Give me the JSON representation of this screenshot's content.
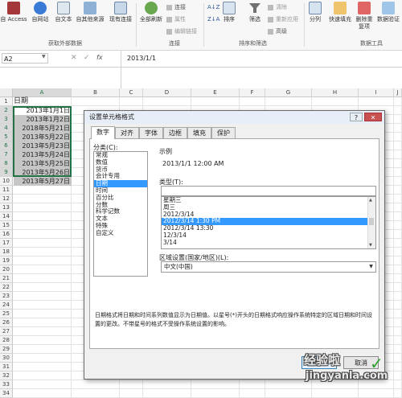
{
  "ribbon": {
    "group1": {
      "buttons": [
        "自 Access",
        "自网站",
        "自文本",
        "自其他来源",
        "现有连接"
      ],
      "label": "获取外部数据"
    },
    "group2": {
      "refresh_label": "全部刷新",
      "small": [
        "连接",
        "属性",
        "编辑链接"
      ],
      "label": "连接"
    },
    "group3": {
      "sort_az": "A↓Z",
      "sort_za": "Z↓A",
      "sort_label": "排序",
      "filter_label": "筛选",
      "small": [
        "清除",
        "重新应用",
        "高级"
      ],
      "label": "排序和筛选"
    },
    "group4": {
      "buttons": [
        "分列",
        "快速填充",
        "删除重复项",
        "数据验证"
      ],
      "label": "数据工具"
    }
  },
  "formula_bar": {
    "name_box": "A2",
    "fx": "fx",
    "value": "2013/1/1"
  },
  "grid": {
    "columns": [
      "A",
      "B",
      "C",
      "D",
      "E",
      "F",
      "G",
      "H",
      "I",
      "J"
    ],
    "rows": [
      "1",
      "2",
      "3",
      "4",
      "5",
      "6",
      "7",
      "8",
      "9",
      "10",
      "11",
      "12",
      "13",
      "14",
      "15",
      "16",
      "17",
      "18",
      "19",
      "20",
      "21",
      "22",
      "23",
      "24",
      "25",
      "26",
      "27",
      "28",
      "29",
      "30",
      "31",
      "32",
      "33",
      "34"
    ],
    "header_cell": "日期",
    "cells": [
      "2013年1月1日",
      "2013年1月2日",
      "2018年5月21日",
      "2013年5月22日",
      "2013年5月23日",
      "2013年5月24日",
      "2013年5月25日",
      "2013年5月26日",
      "2013年5月27日"
    ]
  },
  "dialog": {
    "title": "设置单元格格式",
    "help": "?",
    "close": "✕",
    "tabs": [
      "数字",
      "对齐",
      "字体",
      "边框",
      "填充",
      "保护"
    ],
    "category_label": "分类(C):",
    "categories": [
      "常规",
      "数值",
      "货币",
      "会计专用",
      "日期",
      "时间",
      "百分比",
      "分数",
      "科学记数",
      "文本",
      "特殊",
      "自定义"
    ],
    "selected_category": 4,
    "sample_label": "示例",
    "sample_value": "2013/1/1 12:00 AM",
    "type_label": "类型(T):",
    "types": [
      "星期三",
      "周三",
      "2012/3/14",
      "2012/3/14 1:30 PM",
      "2012/3/14 13:30",
      "12/3/14",
      "3/14"
    ],
    "selected_type": 3,
    "locale_label": "区域设置(国家/地区)(L):",
    "locale_value": "中文(中国)",
    "description": "日期格式将日期和时间系列数值显示为日期值。以星号(*)开头的日期格式响应操作系统特定的区域日期和时间设置的更改。不带星号的格式不受操作系统设置的影响。",
    "ok_label": "确定",
    "cancel_label": "取消"
  },
  "watermark": {
    "text1": "经验啦",
    "text2": "jingyanla.com",
    "check": "✓"
  }
}
